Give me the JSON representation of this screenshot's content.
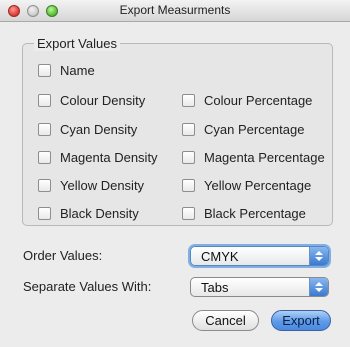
{
  "window": {
    "title": "Export Measurments"
  },
  "export_values": {
    "legend": "Export Values",
    "name": {
      "label": "Name",
      "checked": false
    },
    "density": [
      {
        "label": "Colour Density",
        "checked": false
      },
      {
        "label": "Cyan Density",
        "checked": false
      },
      {
        "label": "Magenta Density",
        "checked": false
      },
      {
        "label": "Yellow Density",
        "checked": false
      },
      {
        "label": "Black Density",
        "checked": false
      }
    ],
    "percentage": [
      {
        "label": "Colour Percentage",
        "checked": false
      },
      {
        "label": "Cyan Percentage",
        "checked": false
      },
      {
        "label": "Magenta Percentage",
        "checked": false
      },
      {
        "label": "Yellow Percentage",
        "checked": false
      },
      {
        "label": "Black Percentage",
        "checked": false
      }
    ]
  },
  "order_values": {
    "label": "Order Values:",
    "selected": "CMYK"
  },
  "separate_values": {
    "label": "Separate Values With:",
    "selected": "Tabs"
  },
  "buttons": {
    "cancel": "Cancel",
    "export": "Export"
  },
  "colors": {
    "default_button": "#5f9ae8",
    "close": "#e0443e",
    "zoom": "#5fc23c"
  },
  "icons": {
    "close": "close-icon",
    "minimize": "minimize-icon",
    "zoom": "zoom-icon",
    "stepper": "up-down-arrows-icon"
  }
}
